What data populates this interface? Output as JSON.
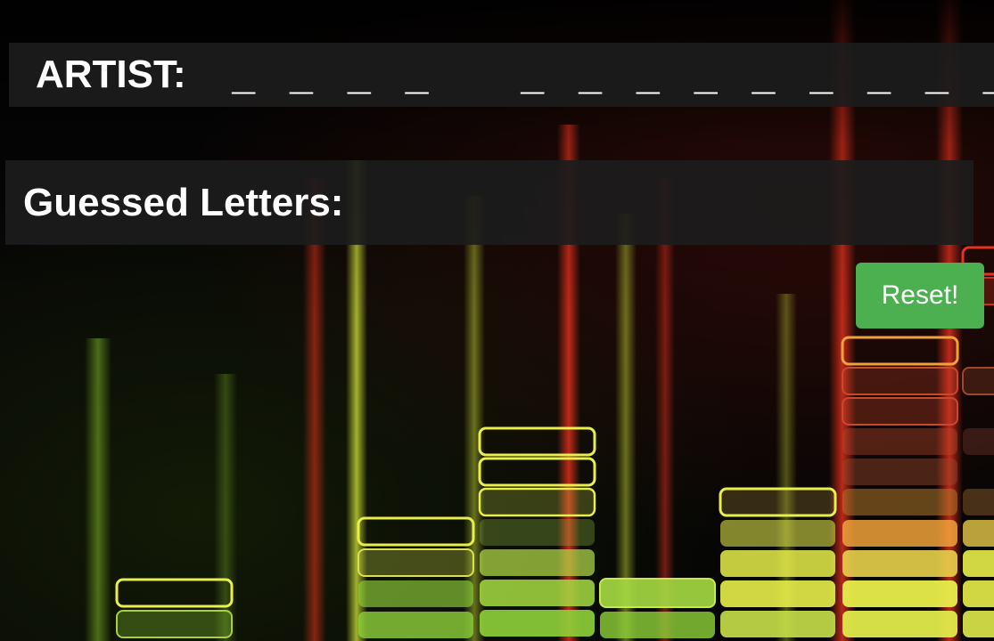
{
  "header": {
    "artist_label": "ARTIST:",
    "artist_blanks": "_ _ _ _   _ _ _ _ _ _ _ _ _   _ _ _ _"
  },
  "guessed": {
    "label": "Guessed Letters:",
    "letters": ""
  },
  "controls": {
    "reset_label": "Reset!"
  },
  "colors": {
    "panel": "#1c1c1c",
    "reset_button": "#4caf50",
    "bar_green": "#8fd13a",
    "bar_yellow": "#e8ee4a",
    "bar_orange": "#f0a23a",
    "beam_red": "#e8321e"
  }
}
